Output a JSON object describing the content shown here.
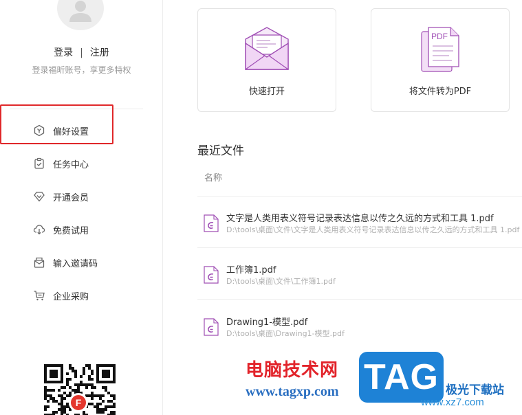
{
  "sidebar": {
    "login": "登录",
    "separator": "|",
    "register": "注册",
    "login_hint": "登录福昕账号，享更多特权",
    "items": [
      {
        "label": "偏好设置",
        "icon": "preferences-icon"
      },
      {
        "label": "任务中心",
        "icon": "task-center-icon"
      },
      {
        "label": "开通会员",
        "icon": "membership-icon"
      },
      {
        "label": "免费试用",
        "icon": "free-trial-icon"
      },
      {
        "label": "输入邀请码",
        "icon": "invite-code-icon"
      },
      {
        "label": "企业采购",
        "icon": "enterprise-purchase-icon"
      }
    ],
    "qr_badge": "F"
  },
  "quick_actions": [
    {
      "label": "快速打开",
      "icon": "envelope-icon"
    },
    {
      "label": "将文件转为PDF",
      "icon": "pdf-convert-icon",
      "art_text": "PDF"
    }
  ],
  "recent": {
    "title": "最近文件",
    "column_name": "名称",
    "files": [
      {
        "name": "文字是人类用表义符号记录表达信息以传之久远的方式和工具 1.pdf",
        "path": "D:\\tools\\桌面\\文件\\文字是人类用表义符号记录表达信息以传之久远的方式和工具 1.pdf"
      },
      {
        "name": "工作簿1.pdf",
        "path": "D:\\tools\\桌面\\文件\\工作簿1.pdf"
      },
      {
        "name": "Drawing1-模型.pdf",
        "path": "D:\\tools\\桌面\\Drawing1-模型.pdf"
      }
    ]
  },
  "watermark": {
    "site_name": "电脑技术网",
    "url": "www.tagxp.com",
    "tag": "TAG",
    "sub_name": "极光下载站",
    "sub_url": "www.xz7.com"
  },
  "colors": {
    "accent_purple": "#a04fb5",
    "highlight_red": "#e0282a",
    "icon_gray": "#666666"
  }
}
